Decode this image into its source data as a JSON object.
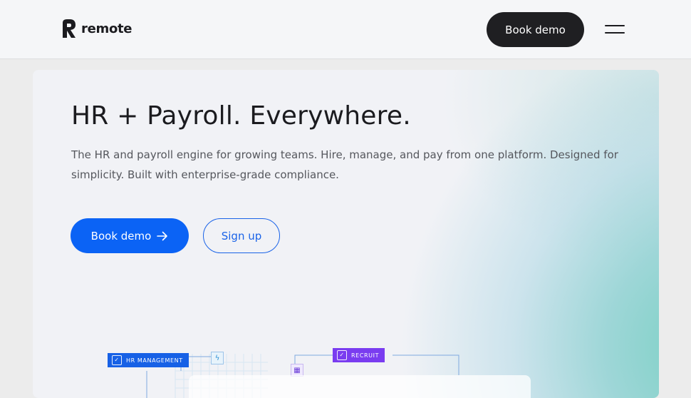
{
  "header": {
    "logo_text": "remote",
    "book_demo_label": "Book demo"
  },
  "hero": {
    "title": "HR + Payroll. Everywhere.",
    "subtitle": "The HR and payroll engine for growing teams. Hire, manage, and pay from one platform. Designed for simplicity. Built with enterprise-grade compliance.",
    "primary_cta_label": "Book demo",
    "primary_cta_icon": "arrow-right-icon",
    "secondary_cta_label": "Sign up"
  },
  "diagram": {
    "hr_chip_label": "HR MANAGEMENT",
    "recruit_chip_label": "RECRUIT"
  },
  "colors": {
    "primary": "#0b63f5",
    "dark_button": "#1f1f22",
    "recruit": "#7a3cf0",
    "hr": "#1761e6"
  }
}
